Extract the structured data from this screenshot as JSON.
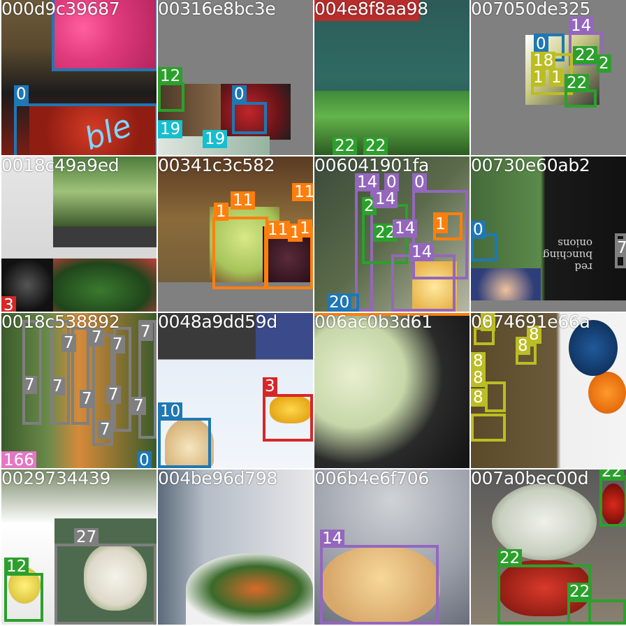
{
  "tiles": [
    {
      "filename": "000d9c39687",
      "labels": [
        "0"
      ]
    },
    {
      "filename": "00316e8bc3e",
      "labels": [
        "12",
        "0",
        "19",
        "19"
      ]
    },
    {
      "filename": "004e8f8aa98",
      "labels": [
        "22",
        "22"
      ]
    },
    {
      "filename": "007050de325",
      "labels": [
        "14",
        "0",
        "18",
        "22",
        "2",
        "1",
        "1",
        "22"
      ]
    },
    {
      "filename": "0018c49a9ed",
      "labels": [
        "3"
      ]
    },
    {
      "filename": "00341c3c582",
      "labels": [
        "11",
        "11",
        "1",
        "11",
        "1",
        "1"
      ]
    },
    {
      "filename": "006041901fa",
      "labels": [
        "14",
        "0",
        "0",
        "2",
        "14",
        "22",
        "14",
        "1",
        "14",
        "20"
      ]
    },
    {
      "filename": "00730e60ab2",
      "labels": [
        "0",
        "7"
      ]
    },
    {
      "filename": "0018c538892",
      "labels": [
        "7",
        "7",
        "7",
        "7",
        "7",
        "7",
        "7",
        "7",
        "7",
        "7",
        "166",
        "0"
      ]
    },
    {
      "filename": "0048a9dd59d",
      "labels": [
        "3",
        "10"
      ]
    },
    {
      "filename": "006ac0b3d61",
      "labels": []
    },
    {
      "filename": "0074691e66a",
      "labels": [
        "8",
        "8",
        "8",
        "8",
        "8",
        "8"
      ]
    },
    {
      "filename": "0029734439",
      "labels": [
        "27",
        "12"
      ]
    },
    {
      "filename": "004be96d798",
      "labels": []
    },
    {
      "filename": "006b4e6f706",
      "labels": [
        "14"
      ]
    },
    {
      "filename": "007a0bec00d",
      "labels": [
        "22",
        "22",
        "22"
      ]
    }
  ],
  "overlay_text": {
    "sign_text": "red bunching onions"
  },
  "colors": {
    "class_0": "#1f77b4",
    "class_3": "#d62728",
    "class_7": "#7f7f7f",
    "class_8": "#bcbd22",
    "class_11": "#ff7f0e",
    "class_12": "#2ca02c",
    "class_14": "#9467bd",
    "class_19": "#17becf",
    "class_22": "#2ca02c",
    "class_166": "#e377c2"
  }
}
